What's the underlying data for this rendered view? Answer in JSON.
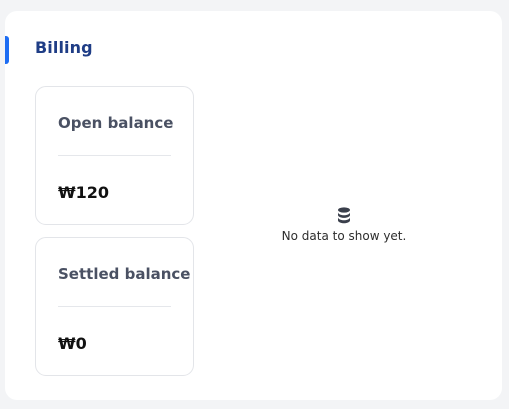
{
  "billing": {
    "title": "Billing",
    "cards": [
      {
        "label": "Open balance",
        "value": "₩120"
      },
      {
        "label": "Settled balance",
        "value": "₩0"
      }
    ],
    "empty_state": {
      "icon": "database-icon",
      "text": "No data to show yet."
    }
  },
  "colors": {
    "accent": "#1d6df3",
    "title": "#1f3d86",
    "label": "#4a5163",
    "background": "#f3f4f6"
  }
}
